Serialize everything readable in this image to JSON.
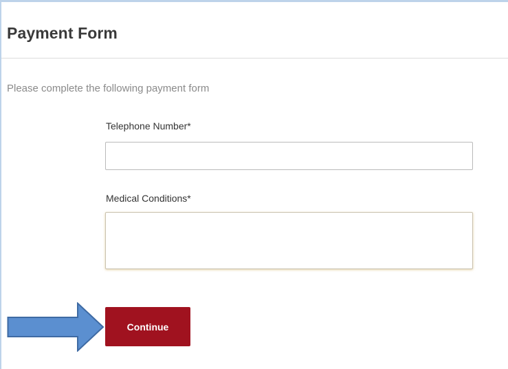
{
  "form": {
    "title": "Payment Form",
    "intro": "Please complete the following payment form"
  },
  "fields": {
    "telephone": {
      "label": "Telephone Number*",
      "value": "",
      "placeholder": ""
    },
    "medical": {
      "label": "Medical Conditions*",
      "value": "",
      "placeholder": ""
    }
  },
  "actions": {
    "continue_label": "Continue"
  },
  "annotation": {
    "icon": "right-arrow-icon",
    "fill_color": "#5b8fd0",
    "stroke_color": "#3e6aa3"
  },
  "colors": {
    "primary_button": "#a0121f",
    "window_border": "#bdd3ea"
  }
}
